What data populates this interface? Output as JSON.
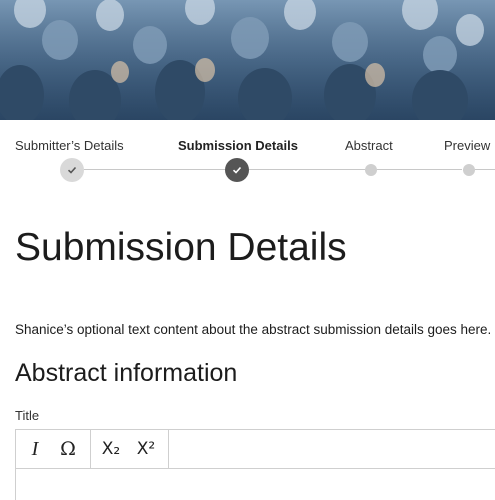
{
  "stepper": {
    "steps": [
      {
        "label": "Submitter’s Details",
        "state": "done"
      },
      {
        "label": "Submission Details",
        "state": "current"
      },
      {
        "label": "Abstract",
        "state": "upcoming"
      },
      {
        "label": "Preview",
        "state": "upcoming"
      }
    ]
  },
  "main": {
    "title": "Submission Details",
    "intro": "Shanice’s optional text content about the abstract submission details goes here.",
    "section_title": "Abstract information",
    "title_field_label": "Title"
  },
  "editor": {
    "toolbar": {
      "italic": "I",
      "special_char": "Ω",
      "subscript": "X₂",
      "superscript": "X²"
    }
  },
  "colors": {
    "step_done": "#d9d9d9",
    "step_current": "#555555",
    "step_upcoming": "#cfcfcf"
  }
}
